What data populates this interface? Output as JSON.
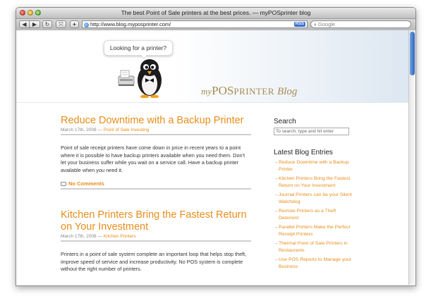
{
  "window": {
    "title": "The best Point of Sale printers at the best prices. — myPOSprinter blog"
  },
  "toolbar": {
    "back_glyph": "◀",
    "forward_glyph": "▶",
    "reload_glyph": "↻",
    "snapback_glyph": "⤧",
    "add_bookmark_glyph": "+",
    "url": "http://www.blog.myposprinter.com/",
    "rss_label": "RSS",
    "search_placeholder": "Google"
  },
  "header": {
    "bubble_text": "Looking for a printer?",
    "brand_my": "my",
    "brand_pos": "POS",
    "brand_printer": "PRINTER",
    "brand_blog": "Blog"
  },
  "posts": [
    {
      "title": "Reduce Downtime with a Backup Printer",
      "date": "March 17th, 2008 —",
      "category": "Point of Sale Investing",
      "body": "Point of sale receipt printers have come down in price in recent years to a point where it is possible to have backup printers available when you need them. Don't let your business suffer while you wait on a service call. Have a backup printer available when you need it.",
      "comments": "No Comments"
    },
    {
      "title": "Kitchen Printers Bring the Fastest Return on Your Investment",
      "date": "March 17th, 2008 —",
      "category": "Kitchen Printers",
      "body": "Printers in a point of sale system complete an important loop that helps stop theft, improve speed of service and increase productivity. No POS system is complete without the right number of printers."
    }
  ],
  "sidebar": {
    "search_heading": "Search",
    "search_placeholder": "To search, type and hit enter",
    "latest_heading": "Latest Blog Entries",
    "entries": [
      "Reduce Downtime with a Backup Printer",
      "Kitchen Printers Bring the Fastest Return on Your Investment",
      "Journal Printers can be your Silent Watchdog",
      "Remote Printers as a Theft Deterrent",
      "Parallel Printers Make the Perfect Receipt Printers",
      "Thermal Point of Sale Printers in Restaurants",
      "Use POS Reports to Manage your Business"
    ]
  },
  "colors": {
    "accent": "#e88d1a",
    "brand": "#a58a52"
  }
}
